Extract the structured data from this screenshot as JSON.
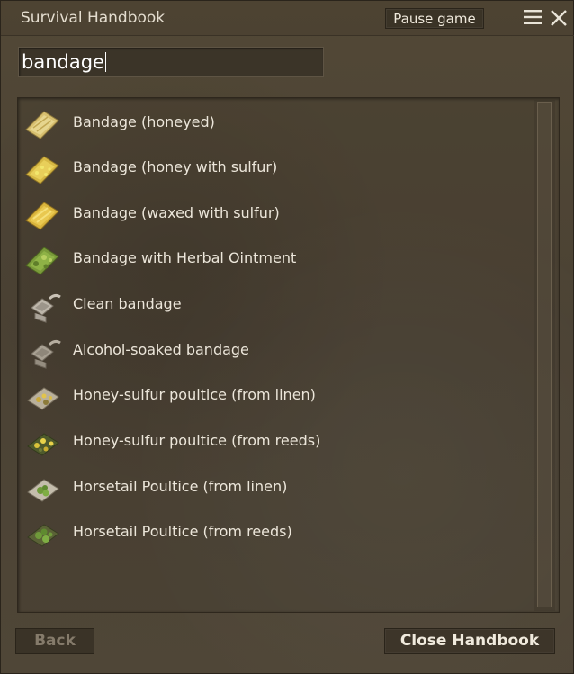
{
  "window": {
    "title": "Survival Handbook",
    "pause_label": "Pause game",
    "menu_icon": "hamburger-menu-icon",
    "close_icon": "close-x-icon"
  },
  "search": {
    "value": "bandage"
  },
  "results": [
    {
      "label": "Bandage (honeyed)",
      "icon": "bandage-honeyed-icon"
    },
    {
      "label": "Bandage (honey with sulfur)",
      "icon": "bandage-honey-sulfur-icon"
    },
    {
      "label": "Bandage (waxed with sulfur)",
      "icon": "bandage-waxed-sulfur-icon"
    },
    {
      "label": "Bandage with Herbal Ointment",
      "icon": "bandage-herbal-icon"
    },
    {
      "label": "Clean bandage",
      "icon": "clean-bandage-icon"
    },
    {
      "label": "Alcohol-soaked bandage",
      "icon": "alcohol-bandage-icon"
    },
    {
      "label": "Honey-sulfur poultice (from linen)",
      "icon": "poultice-linen-sulfur-icon"
    },
    {
      "label": "Honey-sulfur poultice (from reeds)",
      "icon": "poultice-reeds-sulfur-icon"
    },
    {
      "label": "Horsetail Poultice (from linen)",
      "icon": "poultice-linen-horsetail-icon"
    },
    {
      "label": "Horsetail Poultice (from reeds)",
      "icon": "poultice-reeds-horsetail-icon"
    }
  ],
  "footer": {
    "back_label": "Back",
    "close_label": "Close Handbook"
  }
}
